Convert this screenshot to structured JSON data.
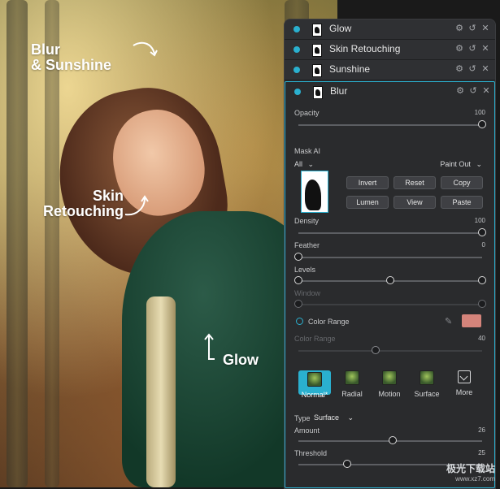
{
  "photo": {
    "callouts": {
      "blur_sunshine_line1": "Blur",
      "blur_sunshine_line2": "& Sunshine",
      "skin_line1": "Skin",
      "skin_line2": "Retouching",
      "glow": "Glow"
    }
  },
  "panel": {
    "layers": [
      {
        "name": "Glow"
      },
      {
        "name": "Skin Retouching"
      },
      {
        "name": "Sunshine"
      },
      {
        "name": "Blur"
      }
    ],
    "row_icons": {
      "gear": "⚙",
      "reset": "↺",
      "close": "✕"
    },
    "blur": {
      "opacity_label": "Opacity",
      "opacity_value": "100",
      "mask_ai_label": "Mask AI",
      "mask_filter_value": "All",
      "paint_mode": "Paint Out",
      "buttons": {
        "invert": "Invert",
        "reset": "Reset",
        "copy": "Copy",
        "lumen": "Lumen",
        "view": "View",
        "paste": "Paste"
      },
      "density_label": "Density",
      "density_value": "100",
      "feather_label": "Feather",
      "feather_value": "0",
      "levels_label": "Levels",
      "window_label": "Window",
      "color_range_label": "Color Range",
      "color_range_slider_label": "Color Range",
      "color_range_value": "40",
      "color_swatch": "#d5847b",
      "presets": [
        {
          "label": "Normal*",
          "active": true
        },
        {
          "label": "Radial"
        },
        {
          "label": "Motion"
        },
        {
          "label": "Surface"
        },
        {
          "label": "More"
        }
      ],
      "type_label": "Type",
      "type_value": "Surface",
      "amount_label": "Amount",
      "amount_value": "26",
      "threshold_label": "Threshold",
      "threshold_value": "25"
    }
  },
  "watermark": {
    "title": "极光下载站",
    "url": "www.xz7.com"
  },
  "colors": {
    "accent": "#2ab0cf",
    "panel_bg": "#2a2b2d"
  }
}
